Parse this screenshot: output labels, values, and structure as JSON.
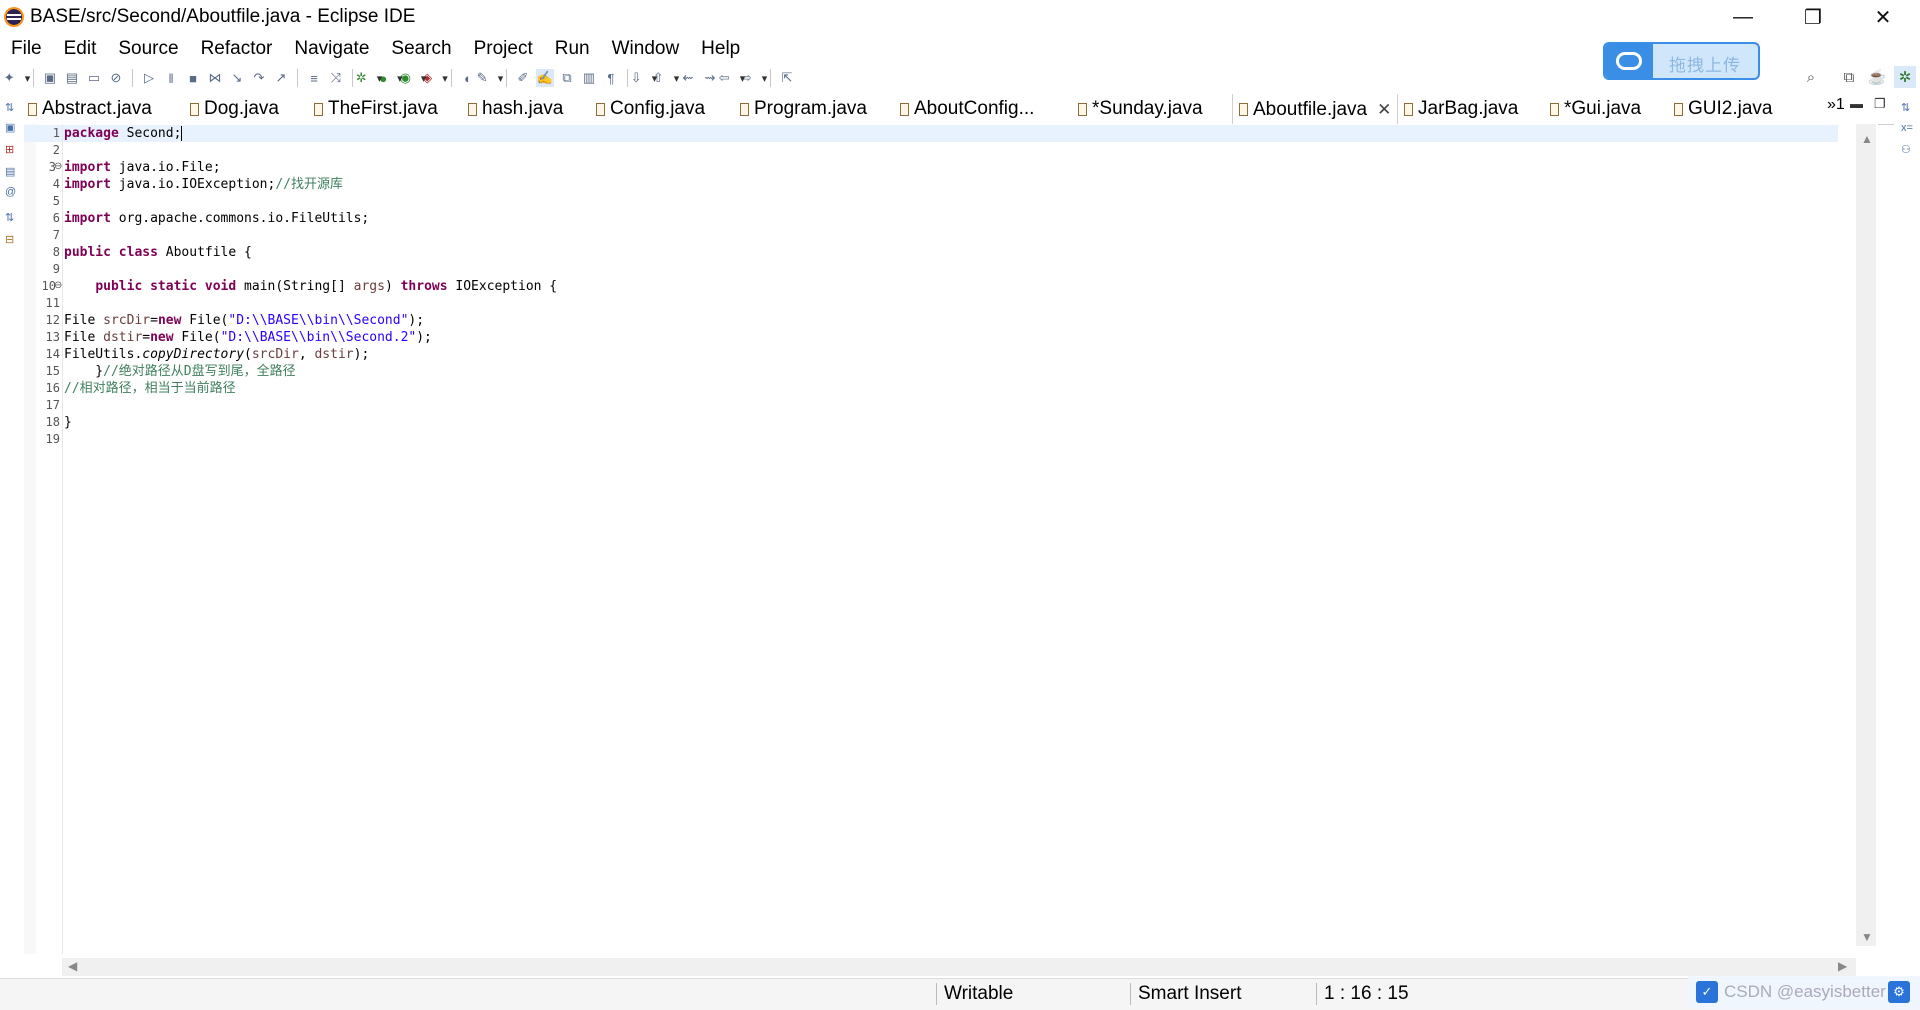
{
  "window": {
    "title": "BASE/src/Second/Aboutfile.java - Eclipse IDE",
    "minimize": "—",
    "restore": "❐",
    "close": "✕"
  },
  "menu": [
    "File",
    "Edit",
    "Source",
    "Refactor",
    "Navigate",
    "Search",
    "Project",
    "Run",
    "Window",
    "Help"
  ],
  "upload_widget": {
    "label": "拖拽上传"
  },
  "tabs": [
    {
      "label": "Abstract.java"
    },
    {
      "label": "Dog.java"
    },
    {
      "label": "TheFirst.java"
    },
    {
      "label": "hash.java"
    },
    {
      "label": "Config.java"
    },
    {
      "label": "Program.java"
    },
    {
      "label": "AboutConfig..."
    },
    {
      "label": "*Sunday.java"
    },
    {
      "label": "Aboutfile.java",
      "active": true
    },
    {
      "label": "JarBag.java"
    },
    {
      "label": "*Gui.java"
    },
    {
      "label": "GUI2.java"
    }
  ],
  "tab_overflow": "»1",
  "code": {
    "line_numbers": [
      "1",
      "2",
      "3",
      "4",
      "5",
      "6",
      "7",
      "8",
      "9",
      "10",
      "11",
      "12",
      "13",
      "14",
      "15",
      "16",
      "17",
      "18",
      "19"
    ],
    "lines": {
      "l1_kw": "package",
      "l1_rest": " Second;",
      "l3_kw": "import",
      "l3_rest": " java.io.File;",
      "l4_kw": "import",
      "l4_rest": " java.io.IOException;",
      "l4_cmt": "//找开源库",
      "l6_kw": "import",
      "l6_rest": " org.apache.commons.io.FileUtils;",
      "l8_kw1": "public",
      "l8_kw2": "class",
      "l8_rest": " Aboutfile {",
      "l10_indent": "    ",
      "l10_kw1": "public",
      "l10_kw2": "static",
      "l10_kw3": "void",
      "l10_mid": " main(String[] ",
      "l10_var": "args",
      "l10_close": ") ",
      "l10_kw4": "throws",
      "l10_rest": " IOException {",
      "l12_a": "File ",
      "l12_var": "srcDir",
      "l12_eq": "=",
      "l12_kw": "new",
      "l12_b": " File(",
      "l12_str": "\"D:\\\\BASE\\\\bin\\\\Second\"",
      "l12_c": ");",
      "l13_a": "File ",
      "l13_var": "dstir",
      "l13_eq": "=",
      "l13_kw": "new",
      "l13_b": " File(",
      "l13_str": "\"D:\\\\BASE\\\\bin\\\\Second.2\"",
      "l13_c": ");",
      "l14_a": "FileUtils.",
      "l14_method": "copyDirectory",
      "l14_b": "(",
      "l14_var1": "srcDir",
      "l14_c": ", ",
      "l14_var2": "dstir",
      "l14_d": ");",
      "l15_a": "    }",
      "l15_cmt": "//绝对路径从D盘写到尾，全路径",
      "l16_cmt": "//相对路径，相当于当前路径",
      "l18": "}"
    }
  },
  "status": {
    "writable": "Writable",
    "insert_mode": "Smart Insert",
    "position": "1 : 16 : 15"
  },
  "watermark": {
    "text": "CSDN @easyisbetter"
  }
}
